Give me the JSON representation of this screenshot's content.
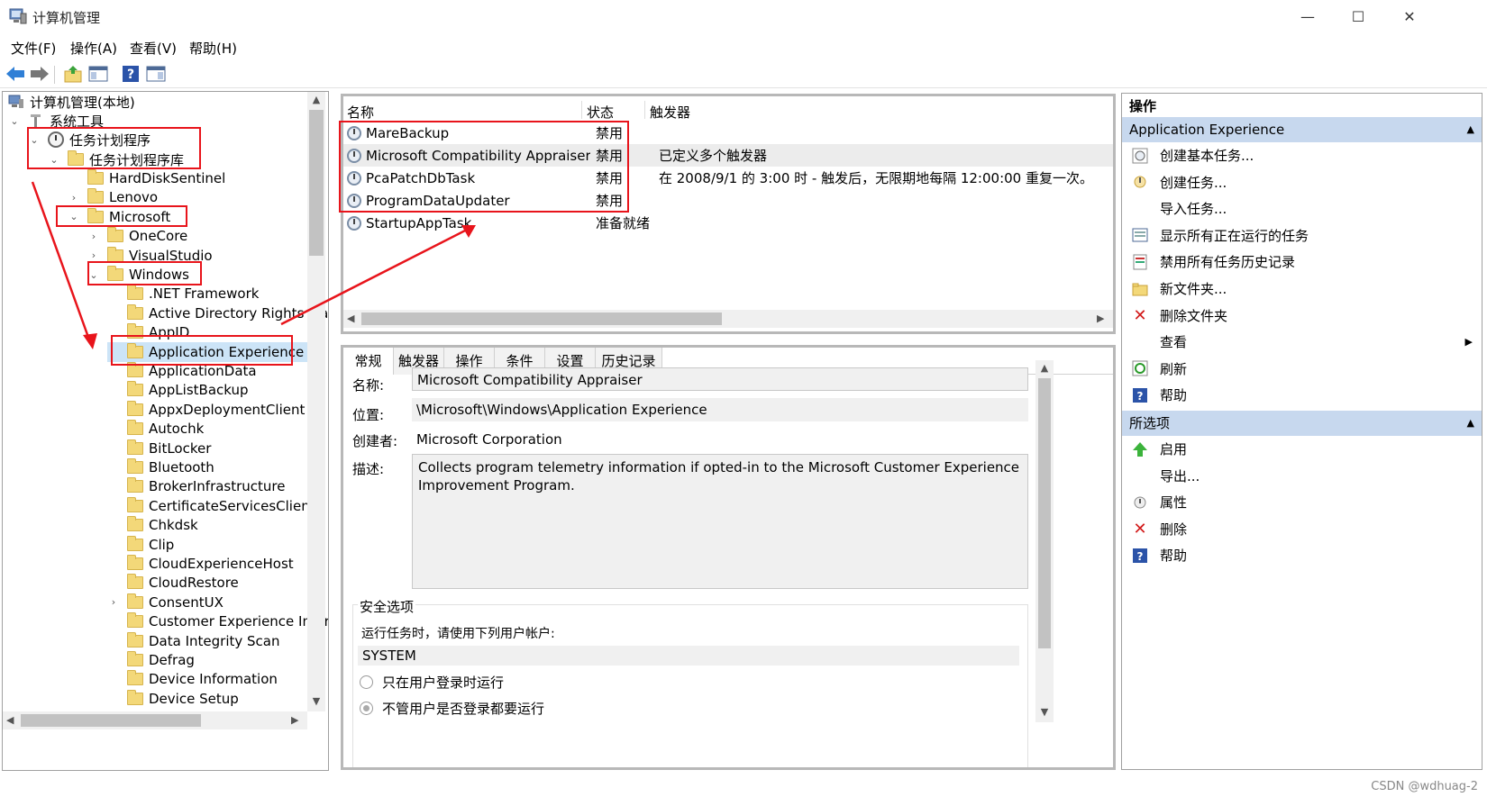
{
  "window": {
    "title": "计算机管理",
    "minimize": "—",
    "maximize": "☐",
    "close": "✕"
  },
  "menu": [
    "文件(F)",
    "操作(A)",
    "查看(V)",
    "帮助(H)"
  ],
  "tree": {
    "root": "计算机管理(本地)",
    "system_tools": "系统工具",
    "task_scheduler": "任务计划程序",
    "task_library": "任务计划程序库",
    "nodes": [
      "HardDiskSentinel",
      "Lenovo",
      "Microsoft",
      "OneCore",
      "VisualStudio",
      "Windows",
      ".NET Framework",
      "Active Directory Rights Ma",
      "AppID",
      "Application Experience",
      "ApplicationData",
      "AppListBackup",
      "AppxDeploymentClient",
      "Autochk",
      "BitLocker",
      "Bluetooth",
      "BrokerInfrastructure",
      "CertificateServicesClient",
      "Chkdsk",
      "Clip",
      "CloudExperienceHost",
      "CloudRestore",
      "ConsentUX",
      "Customer Experience Impr",
      "Data Integrity Scan",
      "Defrag",
      "Device Information",
      "Device Setup"
    ]
  },
  "tasks": {
    "columns": [
      "名称",
      "状态",
      "触发器"
    ],
    "rows": [
      {
        "name": "MareBackup",
        "status": "禁用",
        "trigger": ""
      },
      {
        "name": "Microsoft Compatibility Appraiser",
        "status": "禁用",
        "trigger": "已定义多个触发器"
      },
      {
        "name": "PcaPatchDbTask",
        "status": "禁用",
        "trigger": "在 2008/9/1 的 3:00 时 - 触发后，无限期地每隔 12:00:00 重复一次。"
      },
      {
        "name": "ProgramDataUpdater",
        "status": "禁用",
        "trigger": ""
      },
      {
        "name": "StartupAppTask",
        "status": "准备就绪",
        "trigger": ""
      }
    ]
  },
  "detail": {
    "tabs": [
      "常规",
      "触发器",
      "操作",
      "条件",
      "设置",
      "历史记录"
    ],
    "name_label": "名称:",
    "name_value": "Microsoft Compatibility Appraiser",
    "location_label": "位置:",
    "location_value": "\\Microsoft\\Windows\\Application Experience",
    "author_label": "创建者:",
    "author_value": "Microsoft Corporation",
    "desc_label": "描述:",
    "desc_value": "Collects program telemetry information if opted-in to the Microsoft Customer Experience Improvement Program.",
    "security_title": "安全选项",
    "run_as_label": "运行任务时，请使用下列用户帐户:",
    "run_as_value": "SYSTEM",
    "radio1": "只在用户登录时运行",
    "radio2": "不管用户是否登录都要运行"
  },
  "actions": {
    "title": "操作",
    "section1": "Application Experience",
    "items1": [
      {
        "label": "创建基本任务...",
        "icon": "create-basic-task-icon"
      },
      {
        "label": "创建任务...",
        "icon": "create-task-icon"
      },
      {
        "label": "导入任务...",
        "icon": ""
      },
      {
        "label": "显示所有正在运行的任务",
        "icon": "running-tasks-icon"
      },
      {
        "label": "禁用所有任务历史记录",
        "icon": "history-icon"
      },
      {
        "label": "新文件夹...",
        "icon": "new-folder-icon"
      },
      {
        "label": "删除文件夹",
        "icon": "delete-icon"
      },
      {
        "label": "查看",
        "icon": ""
      },
      {
        "label": "刷新",
        "icon": "refresh-icon"
      },
      {
        "label": "帮助",
        "icon": "help-icon"
      }
    ],
    "section2": "所选项",
    "items2": [
      {
        "label": "启用",
        "icon": "enable-icon"
      },
      {
        "label": "导出...",
        "icon": ""
      },
      {
        "label": "属性",
        "icon": "properties-icon"
      },
      {
        "label": "删除",
        "icon": "delete-icon"
      },
      {
        "label": "帮助",
        "icon": "help-icon"
      }
    ]
  },
  "watermark": "CSDN @wdhuag-2",
  "colors": {
    "accent_header": "#c7d8ee",
    "annotation_red": "#e8141b",
    "folder": "#f3d879"
  }
}
